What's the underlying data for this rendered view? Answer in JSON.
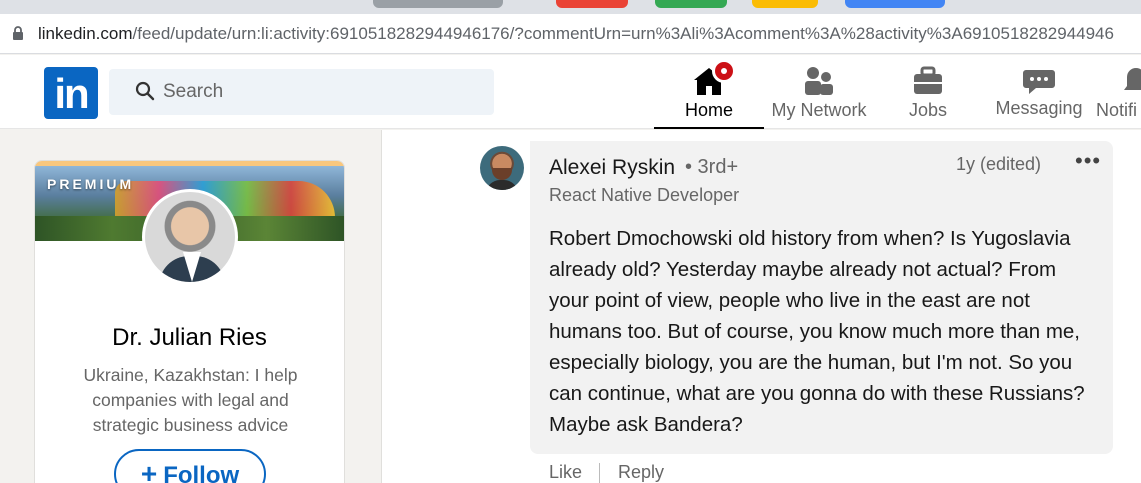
{
  "browser": {
    "url_host": "linkedin.com",
    "url_path": "/feed/update/urn:li:activity:6910518282944946176/?commentUrn=urn%3Ali%3Acomment%3A%28activity%3A6910518282944946",
    "tab_colors": [
      "#9aa0a6",
      "#ea4335",
      "#34a853",
      "#fbbc04",
      "#4285f4"
    ]
  },
  "navbar": {
    "logo_text": "in",
    "search_placeholder": "Search",
    "items": [
      {
        "label": "Home",
        "icon": "home-icon",
        "active": true
      },
      {
        "label": "My Network",
        "icon": "network-icon"
      },
      {
        "label": "Jobs",
        "icon": "briefcase-icon"
      },
      {
        "label": "Messaging",
        "icon": "messaging-icon"
      },
      {
        "label": "Notifi",
        "icon": "bell-icon"
      }
    ],
    "brand_color": "#0a66c2",
    "notification_color": "#cc1016"
  },
  "profile_card": {
    "badge": "PREMIUM",
    "name": "Dr. Julian Ries",
    "headline": "Ukraine, Kazakhstan: I help companies with legal and strategic business advice",
    "follow_label": "Follow",
    "follow_icon": "plus-icon"
  },
  "comment": {
    "author": "Alexei Ryskin",
    "degree": "• 3rd+",
    "author_title": "React Native Developer",
    "time": "1y (edited)",
    "more_icon": "ellipsis-icon",
    "text": "Robert Dmochowski old history from when? Is Yugoslavia already old? Yesterday maybe already not actual? From your point of view, people who live in the east are not humans too. But of course, you know much more than me, especially biology, you are the human, but I'm not. So you can continue, what are you gonna do with these Russians? Maybe ask Bandera?",
    "actions": {
      "like": "Like",
      "reply": "Reply"
    }
  }
}
